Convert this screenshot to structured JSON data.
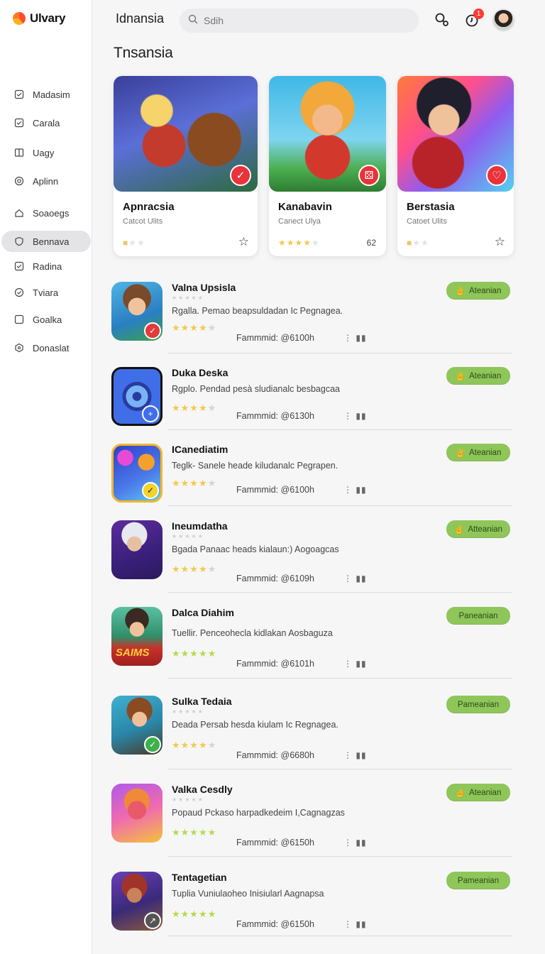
{
  "brand": {
    "name": "Ulvary"
  },
  "sidebar": {
    "items": [
      {
        "label": "Madasim",
        "icon": "check-square-icon",
        "active": false
      },
      {
        "label": "Carala",
        "icon": "check-square-icon",
        "active": false
      },
      {
        "label": "Uagy",
        "icon": "book-icon",
        "active": false
      },
      {
        "label": "Aplinn",
        "icon": "target-icon",
        "active": false
      },
      {
        "label": "Soaoegs",
        "icon": "home-icon",
        "active": false
      },
      {
        "label": "Bennava",
        "icon": "shield-icon",
        "active": true
      },
      {
        "label": "Radina",
        "icon": "check-square-icon",
        "active": false
      },
      {
        "label": "Tviara",
        "icon": "check-circle-icon",
        "active": false
      },
      {
        "label": "Goalka",
        "icon": "square-icon",
        "active": false
      },
      {
        "label": "Donaslat",
        "icon": "hexagon-icon",
        "active": false
      }
    ]
  },
  "header": {
    "title": "Idnansia",
    "search_placeholder": "Sdih",
    "notification_count": "1",
    "icons": [
      "search-icon",
      "notification-icon",
      "avatar"
    ]
  },
  "section": {
    "title": "Tnsansia"
  },
  "featured": [
    {
      "title": "Apnracsia",
      "subtitle": "Catcot Ulits",
      "rating": 1,
      "count": "",
      "action": "star"
    },
    {
      "title": "Kanabavin",
      "subtitle": "Canect Ulya",
      "rating": 4,
      "count": "62",
      "action": ""
    },
    {
      "title": "Berstasia",
      "subtitle": "Catoet Ulits",
      "rating": 1,
      "count": "",
      "action": "star"
    }
  ],
  "apps": [
    {
      "title": "Valna Upsisla",
      "desc": "Rgalla. Pemao beapsuldadan Ic Pegnagea.",
      "rating": 4,
      "meta": "Fammmid: @6100h",
      "button": "Ateanian"
    },
    {
      "title": "Duka Deska",
      "desc": "Rgplo. Pendad pesà sludianalc besbagcaa",
      "rating": 4,
      "meta": "Fammmid: @6130h",
      "button": "Ateanian"
    },
    {
      "title": "ICanediatim",
      "desc": "Teglk- Sanele heade kiludanalc Pegrapen.",
      "rating": 4,
      "meta": "Fammmid: @6100h",
      "button": "Ateanian"
    },
    {
      "title": "Ineumdatha",
      "desc": "Bgada Panaac heads kialaun:) Aogoagcas",
      "rating": 4,
      "meta": "Fammmid: @6109h",
      "button": "Atteanian"
    },
    {
      "title": "Dalca Diahim",
      "desc": "Tuellir. Penceohecla kidlakan Aosbaguza",
      "rating": 5,
      "meta": "Fammmid: @6101h",
      "button": "Paneanian"
    },
    {
      "title": "Sulka Tedaia",
      "desc": "Deada Persab hesda kiulam Ic Regnagea.",
      "rating": 4,
      "meta": "Fammmid: @6680h",
      "button": "Pameanian"
    },
    {
      "title": "Valka Cesdly",
      "desc": "Popaud Pckaso harpadkedeim I,Cagnagzas",
      "rating": 5,
      "meta": "Fammmid: @6150h",
      "button": "Ateanian"
    },
    {
      "title": "Tentagetian",
      "desc": "Tuplia Vuniulaoheo Inisiularl Aagnapsa",
      "rating": 5,
      "meta": "Fammmid: @6150h",
      "button": "Pameanian"
    }
  ],
  "colors": {
    "accent_green": "#8fc65a",
    "star_yellow": "#f2c94c",
    "active_nav": "#e4e4e6"
  }
}
